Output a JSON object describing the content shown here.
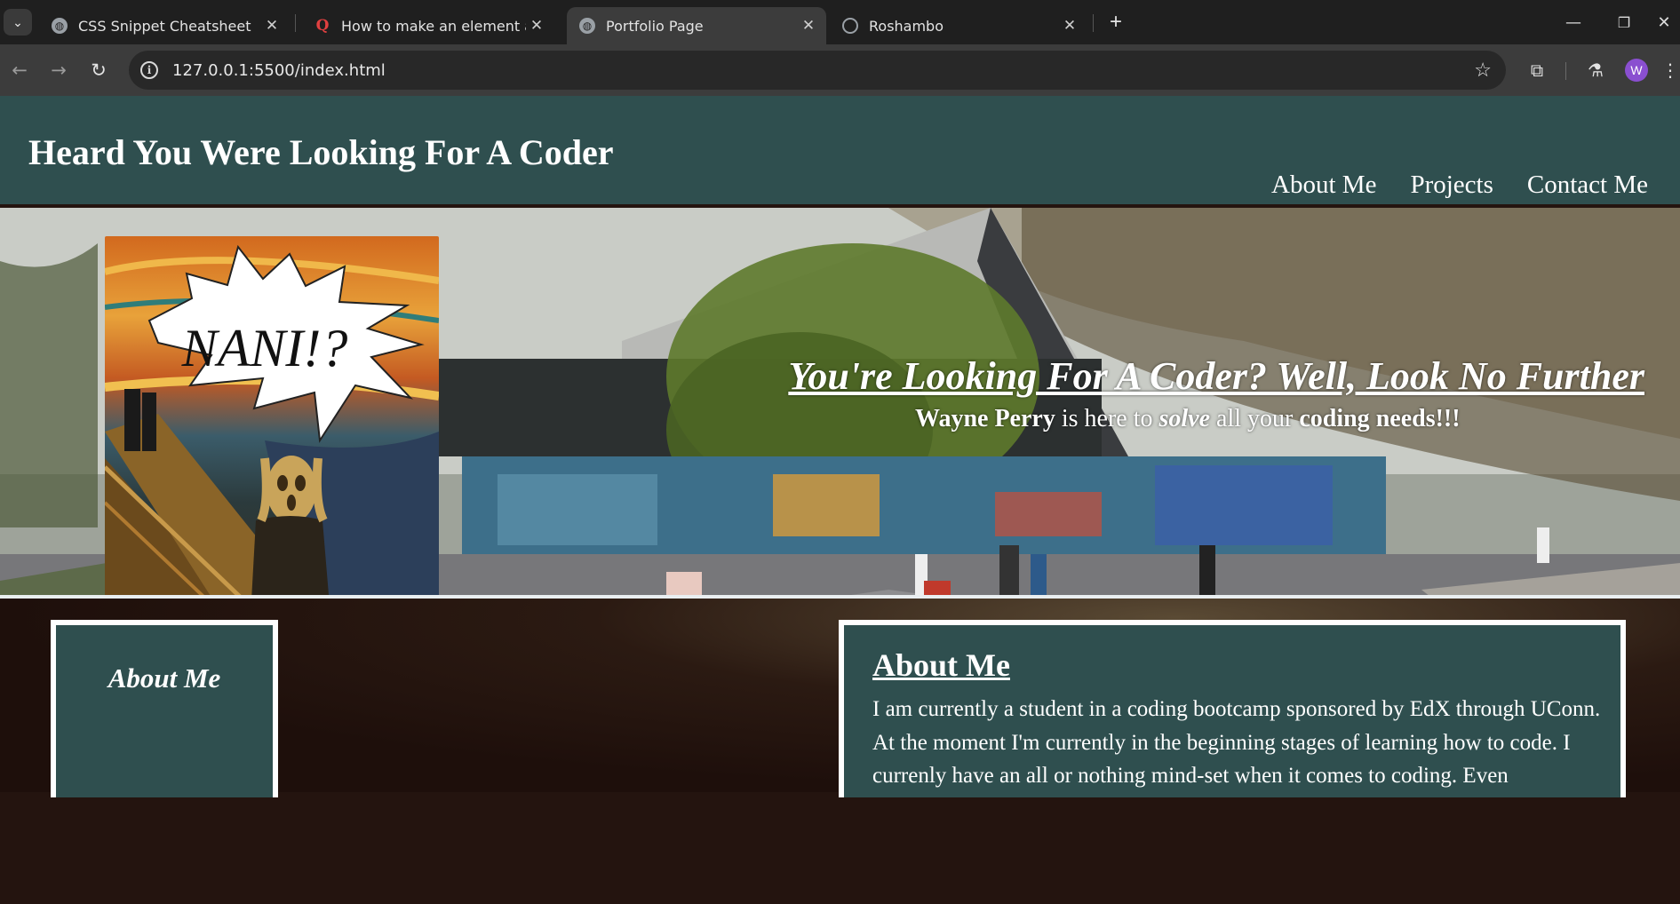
{
  "browser": {
    "tabs": [
      {
        "title": "CSS Snippet Cheatsheet",
        "favicon": "globe-icon",
        "active": false
      },
      {
        "title": "How to make an element appea",
        "favicon": "quora-icon",
        "active": false
      },
      {
        "title": "Portfolio Page",
        "favicon": "globe-icon",
        "active": true
      },
      {
        "title": "Roshambo",
        "favicon": "roshambo-icon",
        "active": false
      }
    ],
    "close_glyph": "✕",
    "new_tab_glyph": "+",
    "url": "127.0.0.1:5500/index.html",
    "profile_initial": "W",
    "accent_color": "#8a4fd0"
  },
  "site": {
    "title": "Heard You Were Looking For A Coder",
    "nav": [
      "About Me",
      "Projects",
      "Contact Me"
    ],
    "header_color": "#2f4f4f"
  },
  "hero": {
    "speech_bubble": "NANI!?",
    "heading": "You're Looking For A Coder? Well, Look No Further",
    "subtitle": {
      "name": "Wayne Perry",
      "part1": " is here to ",
      "verb": "solve",
      "part2": " all your ",
      "emph1": "coding",
      "space": " ",
      "emph2": "needs!!!"
    }
  },
  "aside": {
    "title": "About Me"
  },
  "about": {
    "title": "About Me",
    "body": "I am currently a student in a coding bootcamp sponsored by EdX through UConn. At the moment I'm currently in the beginning stages of learning how to code. I currenly have an all or nothing mind-set when it comes to coding. Even"
  }
}
